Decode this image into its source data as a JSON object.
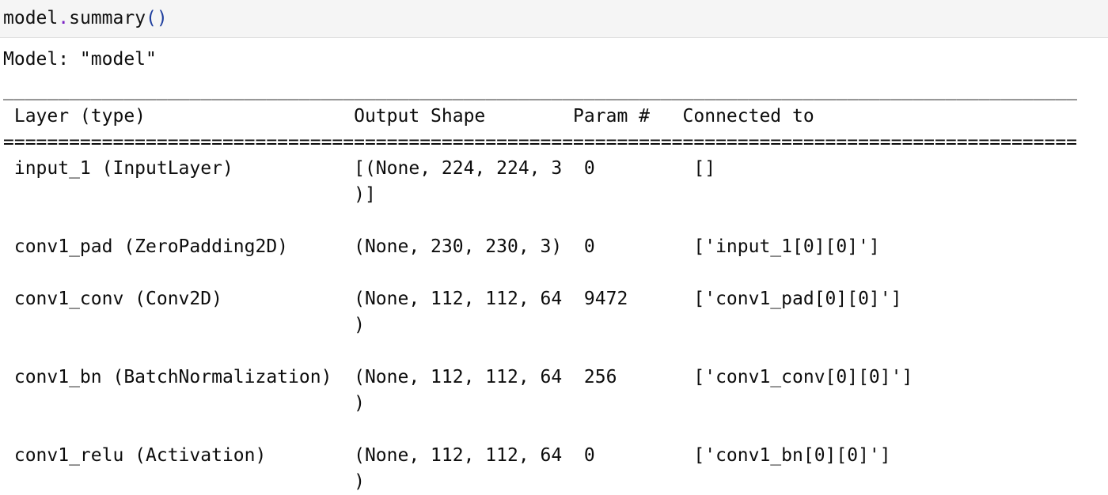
{
  "cell": {
    "input_code": "model.summary()",
    "tokens": {
      "object": "model",
      "dot": ".",
      "method": "summary",
      "parens": "()"
    },
    "colors": {
      "cell_background": "#f5f5f5",
      "cell_border": "#e0e0e0",
      "output_background": "#ffffff",
      "text": "#0d0d0d",
      "operator": "#7a21c4",
      "paren": "#1f3f9e"
    }
  },
  "output": {
    "model_title": "Model: \"model\"",
    "separator_top": "__________________________________________________________________________________________________",
    "separator_header": "==================================================================================================",
    "columns": {
      "layer": "Layer (type)",
      "output_shape": "Output Shape",
      "param": "Param #",
      "connected": "Connected to"
    },
    "header_row": " Layer (type)                   Output Shape        Param #   Connected to                 ",
    "rows": [
      {
        "layer": "input_1 (InputLayer)",
        "output_shape": "[(None, 224, 224, 3",
        "output_shape_cont": ")]",
        "param": "0",
        "connected": "[]",
        "line1": " input_1 (InputLayer)           [(None, 224, 224, 3  0         []                           ",
        "line2": "                                )]                                                         "
      },
      {
        "layer": "conv1_pad (ZeroPadding2D)",
        "output_shape": "(None, 230, 230, 3)",
        "output_shape_cont": "",
        "param": "0",
        "connected": "['input_1[0][0]']",
        "line1": " conv1_pad (ZeroPadding2D)      (None, 230, 230, 3)  0         ['input_1[0][0]']            ",
        "line2": ""
      },
      {
        "layer": "conv1_conv (Conv2D)",
        "output_shape": "(None, 112, 112, 64",
        "output_shape_cont": ")",
        "param": "9472",
        "connected": "['conv1_pad[0][0]']",
        "line1": " conv1_conv (Conv2D)            (None, 112, 112, 64  9472      ['conv1_pad[0][0]']          ",
        "line2": "                                )                                                          "
      },
      {
        "layer": "conv1_bn (BatchNormalization)",
        "output_shape": "(None, 112, 112, 64",
        "output_shape_cont": ")",
        "param": "256",
        "connected": "['conv1_conv[0][0]']",
        "line1": " conv1_bn (BatchNormalization)  (None, 112, 112, 64  256       ['conv1_conv[0][0]']         ",
        "line2": "                                )                                                          "
      },
      {
        "layer": "conv1_relu (Activation)",
        "output_shape": "(None, 112, 112, 64",
        "output_shape_cont": ")",
        "param": "0",
        "connected": "['conv1_bn[0][0]']",
        "line1": " conv1_relu (Activation)        (None, 112, 112, 64  0         ['conv1_bn[0][0]']           ",
        "line2": "                                )                                                          "
      }
    ]
  }
}
